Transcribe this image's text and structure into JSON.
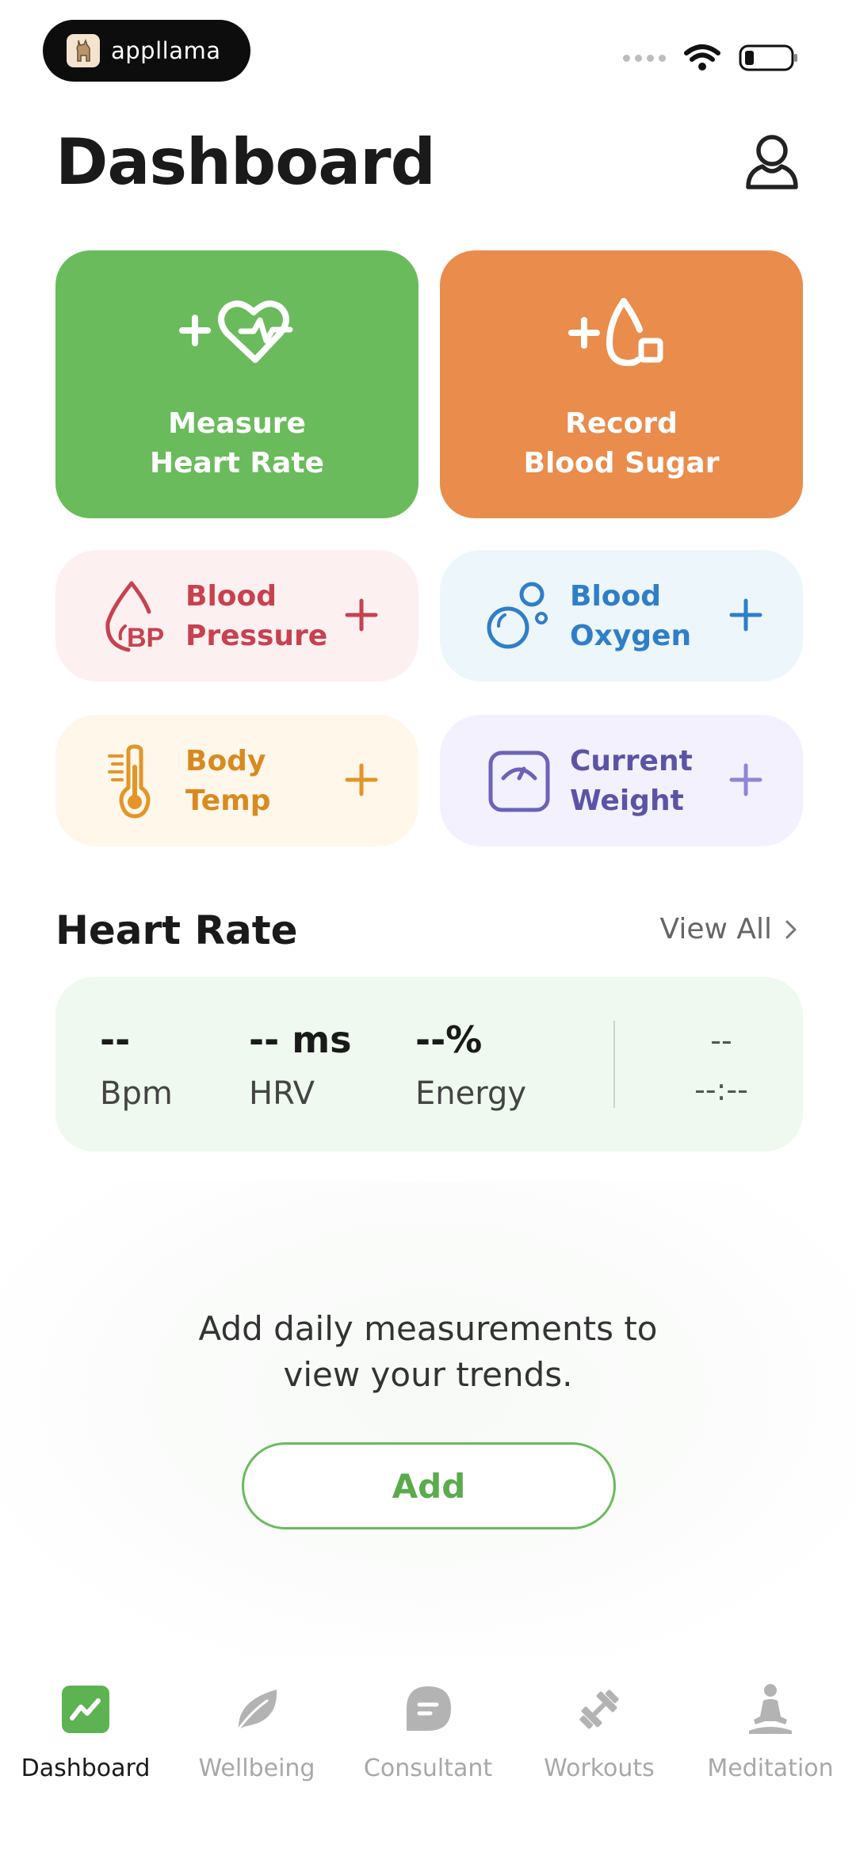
{
  "status_bar": {
    "brand": "appllama"
  },
  "header": {
    "title": "Dashboard"
  },
  "actions": {
    "heart_rate": {
      "label": "Measure\nHeart Rate",
      "color": "#6abb5c"
    },
    "blood_sugar": {
      "label": "Record\nBlood Sugar",
      "color": "#e98c4c"
    }
  },
  "quick_cards": {
    "blood_pressure": {
      "label": "Blood\nPressure",
      "color": "#c8414f",
      "bg": "#fdf0f1",
      "icon": "blood-drop-bp-icon"
    },
    "blood_oxygen": {
      "label": "Blood\nOxygen",
      "color": "#2f7ec8",
      "bg": "#edf6fb",
      "icon": "bubbles-icon"
    },
    "body_temp": {
      "label": "Body\nTemp",
      "color": "#d88a22",
      "bg": "#fef7ea",
      "icon": "thermometer-icon"
    },
    "current_weight": {
      "label": "Current\nWeight",
      "color": "#5b54a6",
      "bg": "#f2f1fd",
      "icon": "scale-icon"
    }
  },
  "heart_rate_section": {
    "title": "Heart Rate",
    "view_all": "View All",
    "metrics": [
      {
        "value": "--",
        "label": "Bpm"
      },
      {
        "value": "-- ms",
        "label": "HRV"
      },
      {
        "value": "--%",
        "label": "Energy"
      }
    ],
    "last_value": "--",
    "last_time": "--:--"
  },
  "empty_state": {
    "message": "Add daily measurements to\nview your trends.",
    "button": "Add"
  },
  "tabs": [
    {
      "label": "Dashboard",
      "icon": "dashboard-icon",
      "active": true
    },
    {
      "label": "Wellbeing",
      "icon": "leaf-icon",
      "active": false
    },
    {
      "label": "Consultant",
      "icon": "chat-icon",
      "active": false
    },
    {
      "label": "Workouts",
      "icon": "dumbbell-icon",
      "active": false
    },
    {
      "label": "Meditation",
      "icon": "meditation-icon",
      "active": false
    }
  ]
}
